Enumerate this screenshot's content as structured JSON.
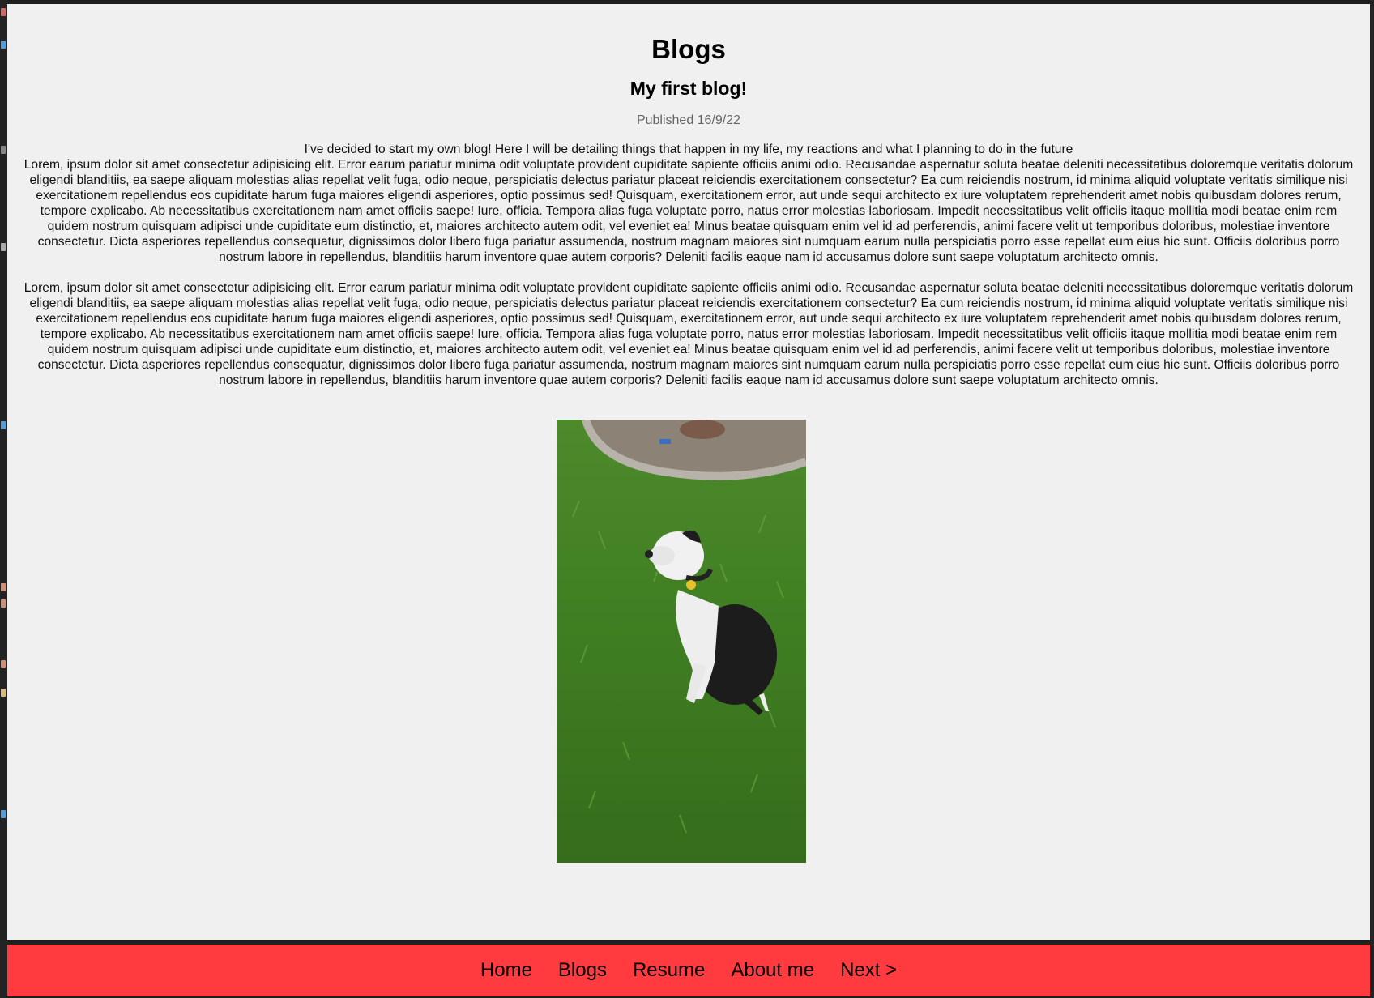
{
  "page": {
    "title": "Blogs",
    "post_title": "My first blog!",
    "published": "Published 16/9/22",
    "intro": "I've decided to start my own blog! Here I will be detailing things that happen in my life, my reactions and what I planning to do in the future",
    "paragraphs": [
      "Lorem, ipsum dolor sit amet consectetur adipisicing elit. Error earum pariatur minima odit voluptate provident cupiditate sapiente officiis animi odio. Recusandae aspernatur soluta beatae deleniti necessitatibus doloremque veritatis dolorum eligendi blanditiis, ea saepe aliquam molestias alias repellat velit fuga, odio neque, perspiciatis delectus pariatur placeat reiciendis exercitationem consectetur? Ea cum reiciendis nostrum, id minima aliquid voluptate veritatis similique nisi exercitationem repellendus eos cupiditate harum fuga maiores eligendi asperiores, optio possimus sed! Quisquam, exercitationem error, aut unde sequi architecto ex iure voluptatem reprehenderit amet nobis quibusdam dolores rerum, tempore explicabo. Ab necessitatibus exercitationem nam amet officiis saepe! Iure, officia. Tempora alias fuga voluptate porro, natus error molestias laboriosam. Impedit necessitatibus velit officiis itaque mollitia modi beatae enim rem quidem nostrum quisquam adipisci unde cupiditate eum distinctio, et, maiores architecto autem odit, vel eveniet ea! Minus beatae quisquam enim vel id ad perferendis, animi facere velit ut temporibus doloribus, molestiae inventore consectetur. Dicta asperiores repellendus consequatur, dignissimos dolor libero fuga pariatur assumenda, nostrum magnam maiores sint numquam earum nulla perspiciatis porro esse repellat eum eius hic sunt. Officiis doloribus porro nostrum labore in repellendus, blanditiis harum inventore quae autem corporis? Deleniti facilis eaque nam id accusamus dolore sunt saepe voluptatum architecto omnis.",
      "Lorem, ipsum dolor sit amet consectetur adipisicing elit. Error earum pariatur minima odit voluptate provident cupiditate sapiente officiis animi odio. Recusandae aspernatur soluta beatae deleniti necessitatibus doloremque veritatis dolorum eligendi blanditiis, ea saepe aliquam molestias alias repellat velit fuga, odio neque, perspiciatis delectus pariatur placeat reiciendis exercitationem consectetur? Ea cum reiciendis nostrum, id minima aliquid voluptate veritatis similique nisi exercitationem repellendus eos cupiditate harum fuga maiores eligendi asperiores, optio possimus sed! Quisquam, exercitationem error, aut unde sequi architecto ex iure voluptatem reprehenderit amet nobis quibusdam dolores rerum, tempore explicabo. Ab necessitatibus exercitationem nam amet officiis saepe! Iure, officia. Tempora alias fuga voluptate porro, natus error molestias laboriosam. Impedit necessitatibus velit officiis itaque mollitia modi beatae enim rem quidem nostrum quisquam adipisci unde cupiditate eum distinctio, et, maiores architecto autem odit, vel eveniet ea! Minus beatae quisquam enim vel id ad perferendis, animi facere velit ut temporibus doloribus, molestiae inventore consectetur. Dicta asperiores repellendus consequatur, dignissimos dolor libero fuga pariatur assumenda, nostrum magnam maiores sint numquam earum nulla perspiciatis porro esse repellat eum eius hic sunt. Officiis doloribus porro nostrum labore in repellendus, blanditiis harum inventore quae autem corporis? Deleniti facilis eaque nam id accusamus dolore sunt saepe voluptatum architecto omnis."
    ]
  },
  "nav": {
    "items": [
      "Home",
      "Blogs",
      "Resume",
      "About me",
      "Next >"
    ]
  },
  "colors": {
    "nav_background": "#ff3b3f",
    "page_background": "#f0f0f0",
    "published_text": "#666666"
  }
}
